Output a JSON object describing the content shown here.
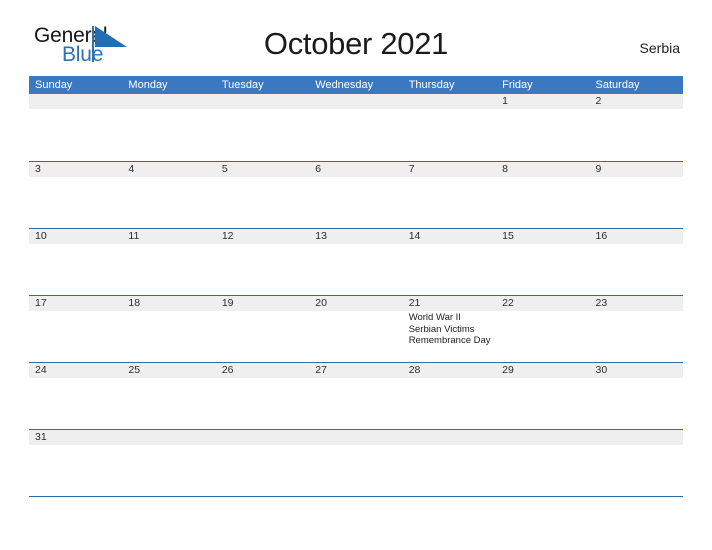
{
  "brand": {
    "word_one": "General",
    "word_two": "Blue",
    "flag_icon": "blue-triangle-flag-icon",
    "colors": {
      "black": "#161616",
      "blue": "#2b73b8"
    }
  },
  "header": {
    "title": "October 2021",
    "country": "Serbia"
  },
  "theme": {
    "header_blue": "#3b78c2",
    "rule_blue": "#2e6da4",
    "band_gray": "#efefef"
  },
  "calendar": {
    "weekdays": [
      "Sunday",
      "Monday",
      "Tuesday",
      "Wednesday",
      "Thursday",
      "Friday",
      "Saturday"
    ],
    "weeks": [
      {
        "days": [
          {
            "num": ""
          },
          {
            "num": ""
          },
          {
            "num": ""
          },
          {
            "num": ""
          },
          {
            "num": ""
          },
          {
            "num": "1"
          },
          {
            "num": "2"
          }
        ]
      },
      {
        "days": [
          {
            "num": "3"
          },
          {
            "num": "4"
          },
          {
            "num": "5"
          },
          {
            "num": "6"
          },
          {
            "num": "7"
          },
          {
            "num": "8"
          },
          {
            "num": "9"
          }
        ]
      },
      {
        "days": [
          {
            "num": "10"
          },
          {
            "num": "11"
          },
          {
            "num": "12"
          },
          {
            "num": "13"
          },
          {
            "num": "14"
          },
          {
            "num": "15"
          },
          {
            "num": "16"
          }
        ]
      },
      {
        "days": [
          {
            "num": "17"
          },
          {
            "num": "18"
          },
          {
            "num": "19"
          },
          {
            "num": "20"
          },
          {
            "num": "21",
            "events": [
              "World War II",
              "Serbian Victims",
              "Remembrance Day"
            ]
          },
          {
            "num": "22"
          },
          {
            "num": "23"
          }
        ]
      },
      {
        "days": [
          {
            "num": "24"
          },
          {
            "num": "25"
          },
          {
            "num": "26"
          },
          {
            "num": "27"
          },
          {
            "num": "28"
          },
          {
            "num": "29"
          },
          {
            "num": "30"
          }
        ]
      },
      {
        "days": [
          {
            "num": "31"
          },
          {
            "num": ""
          },
          {
            "num": ""
          },
          {
            "num": ""
          },
          {
            "num": ""
          },
          {
            "num": ""
          },
          {
            "num": ""
          }
        ]
      }
    ]
  }
}
